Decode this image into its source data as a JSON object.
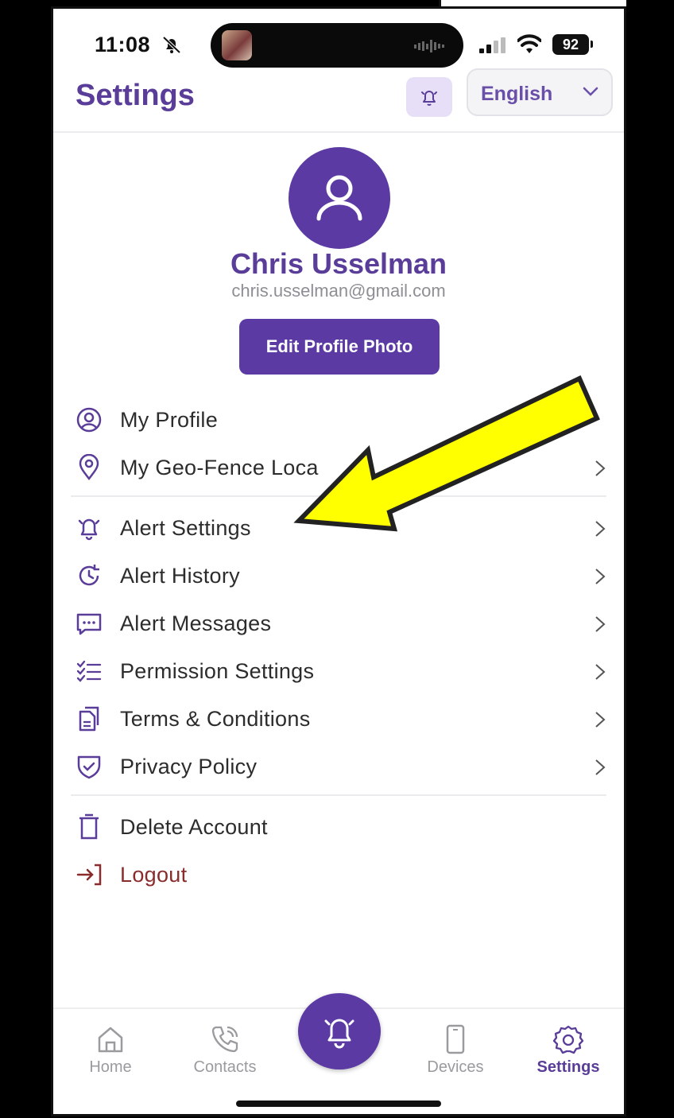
{
  "status_bar": {
    "time": "11:08",
    "battery": "92"
  },
  "header": {
    "title": "Settings",
    "language": "English"
  },
  "profile": {
    "name": "Chris Usselman",
    "email": "chris.usselman@gmail.com",
    "edit_photo_label": "Edit Profile Photo"
  },
  "menu": {
    "my_profile": "My Profile",
    "geo_fence": "My Geo-Fence Loca",
    "alert_settings": "Alert Settings",
    "alert_history": "Alert History",
    "alert_messages": "Alert Messages",
    "permission_settings": "Permission Settings",
    "terms": "Terms & Conditions",
    "privacy": "Privacy Policy",
    "delete_account": "Delete Account",
    "logout": "Logout"
  },
  "tabbar": {
    "home": "Home",
    "contacts": "Contacts",
    "devices": "Devices",
    "settings": "Settings"
  },
  "colors": {
    "brand_purple": "#5b3aa4",
    "title_purple": "#5a3d99",
    "logout_red": "#8a2c2c",
    "annotation_arrow": "#ffff00"
  },
  "icons": [
    "mute-bell-icon",
    "bell-icon",
    "chevron-down-icon",
    "user-icon",
    "user-circle-icon",
    "location-pin-icon",
    "alarm-bell-icon",
    "history-icon",
    "message-icon",
    "checklist-icon",
    "document-icon",
    "shield-check-icon",
    "trash-icon",
    "logout-icon",
    "home-icon",
    "phone-icon",
    "device-icon",
    "gear-icon",
    "chevron-right-icon"
  ]
}
